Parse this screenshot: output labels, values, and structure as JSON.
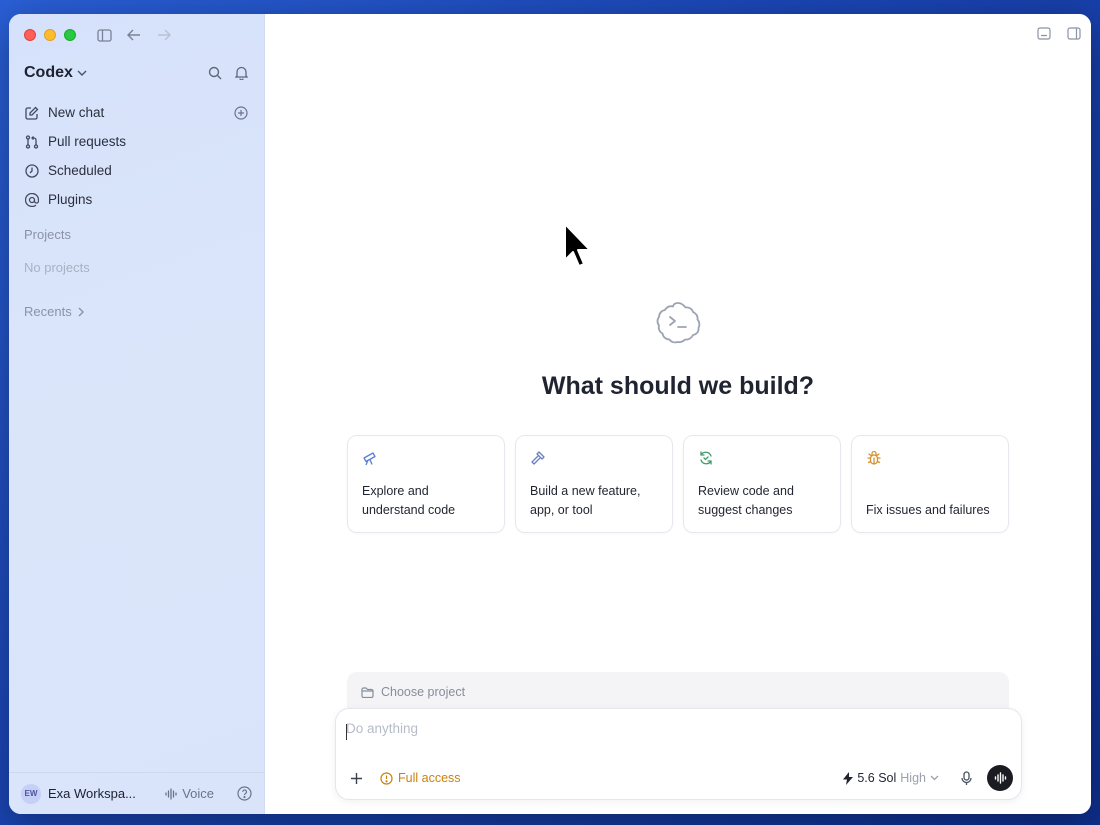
{
  "window": {
    "traffic_lights": [
      "close",
      "minimize",
      "maximize"
    ]
  },
  "sidebar": {
    "app_name": "Codex",
    "nav": [
      {
        "label": "New chat",
        "icon": "edit-icon"
      },
      {
        "label": "Pull requests",
        "icon": "pull-request-icon"
      },
      {
        "label": "Scheduled",
        "icon": "clock-icon"
      },
      {
        "label": "Plugins",
        "icon": "at-icon"
      }
    ],
    "projects_title": "Projects",
    "projects_empty": "No projects",
    "recents_label": "Recents",
    "footer": {
      "workspace_initials": "EW",
      "workspace_name": "Exa Workspa...",
      "voice_label": "Voice"
    }
  },
  "main": {
    "title": "What should we build?",
    "cards": [
      {
        "text": "Explore and understand code",
        "icon": "telescope-icon",
        "color": "#5b7fd6"
      },
      {
        "text": "Build a new feature, app, or tool",
        "icon": "hammer-icon",
        "color": "#6b7fc4"
      },
      {
        "text": "Review code and suggest changes",
        "icon": "refresh-check-icon",
        "color": "#3f9c6a"
      },
      {
        "text": "Fix issues and failures",
        "icon": "bug-icon",
        "color": "#d8912a"
      }
    ],
    "choose_project": "Choose project",
    "composer": {
      "placeholder": "Do anything",
      "access_label": "Full access",
      "model_name": "5.6 Sol",
      "effort": "High"
    }
  },
  "colors": {
    "accent_warning": "#c9820f",
    "sidebar_bg": "#d9e4fb"
  }
}
